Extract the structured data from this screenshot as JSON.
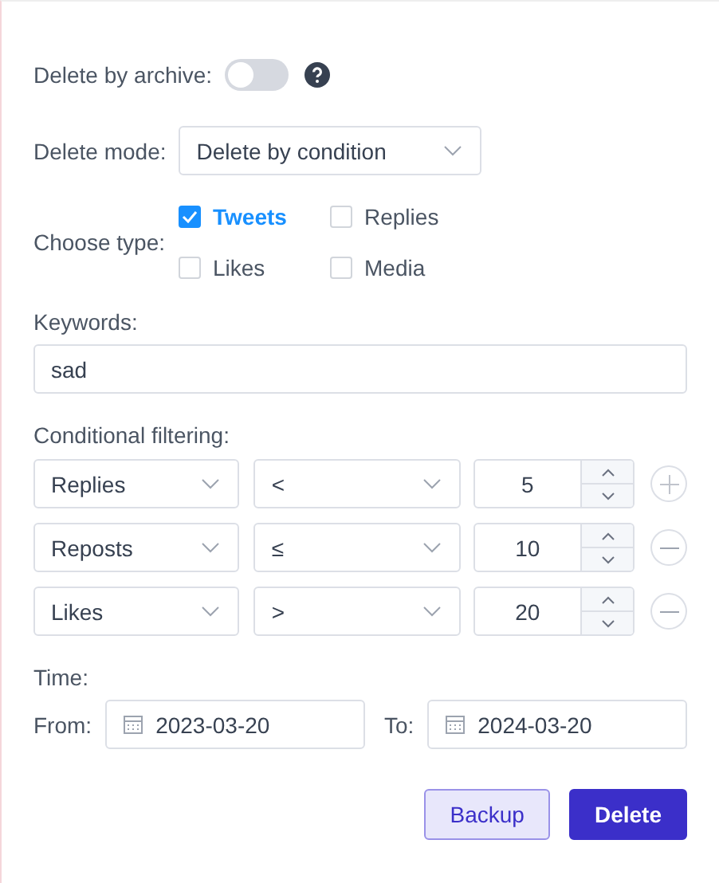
{
  "archive": {
    "label": "Delete by archive:",
    "on": false
  },
  "mode": {
    "label": "Delete mode:",
    "value": "Delete by condition"
  },
  "type": {
    "label": "Choose type:",
    "options": [
      {
        "label": "Tweets",
        "checked": true
      },
      {
        "label": "Replies",
        "checked": false
      },
      {
        "label": "Likes",
        "checked": false
      },
      {
        "label": "Media",
        "checked": false
      }
    ]
  },
  "keywords": {
    "label": "Keywords:",
    "value": "sad"
  },
  "filtering": {
    "label": "Conditional filtering:",
    "rows": [
      {
        "field": "Replies",
        "operator": "<",
        "value": "5",
        "kind": "add"
      },
      {
        "field": "Reposts",
        "operator": "≤",
        "value": "10",
        "kind": "remove"
      },
      {
        "field": "Likes",
        "operator": ">",
        "value": "20",
        "kind": "remove"
      }
    ]
  },
  "time": {
    "label": "Time:",
    "from_label": "From:",
    "from": "2023-03-20",
    "to_label": "To:",
    "to": "2024-03-20"
  },
  "buttons": [
    {
      "label": "Backup",
      "kind": "secondary"
    },
    {
      "label": "Delete",
      "kind": "primary"
    }
  ]
}
